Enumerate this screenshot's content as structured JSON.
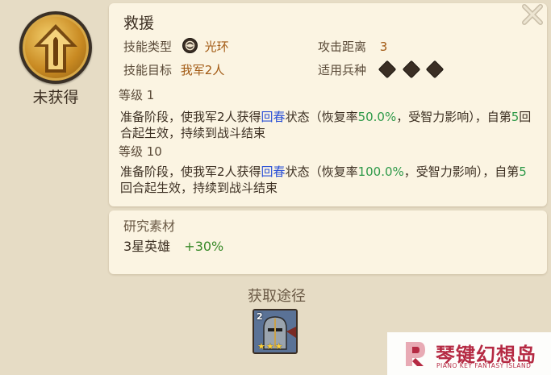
{
  "skill": {
    "status": "未获得",
    "name": "救援",
    "type_label": "技能类型",
    "type_value": "光环",
    "range_label": "攻击距离",
    "range_value": "3",
    "target_label": "技能目标",
    "target_value": "我军2人",
    "troops_label": "适用兵种",
    "troop_icons": [
      "sword-icon",
      "horse-icon",
      "bow-icon"
    ]
  },
  "levels": [
    {
      "label": "等级 1",
      "desc": {
        "p1": "准备阶段，使我军2人获得",
        "effect": "回春",
        "p2": "状态（恢复率",
        "rate": "50.0%",
        "p3": "，受智力影响），自第",
        "turn": "5",
        "p4": "回合起生效，持续到战斗结束"
      }
    },
    {
      "label": "等级 10",
      "desc": {
        "p1": "准备阶段，使我军2人获得",
        "effect": "回春",
        "p2": "状态（恢复率",
        "rate": "100.0%",
        "p3": "，受智力影响），自第",
        "turn": "5",
        "p4": "回合起生效，持续到战斗结束"
      }
    }
  ],
  "research": {
    "title": "研究素材",
    "item": "3星英雄",
    "bonus": "+30%"
  },
  "source": {
    "title": "获取途径",
    "hero_level": "2",
    "hero_stars": "★★★"
  },
  "watermark": {
    "cn": "琴键幻想岛",
    "en": "PIANO KEY FANTASY ISLAND"
  },
  "colors": {
    "accent_orange": "#a25a14",
    "highlight_blue": "#2a4fd6",
    "number_green": "#2f9a4a",
    "bonus_green": "#3a8a2a",
    "watermark_red": "#b52a43"
  }
}
